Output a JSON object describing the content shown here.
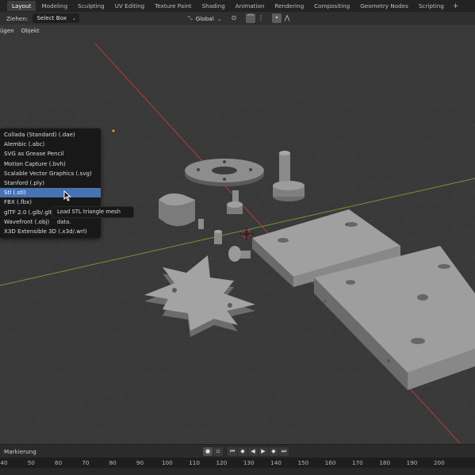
{
  "workspace_tabs": [
    "Layout",
    "Modeling",
    "Sculpting",
    "UV Editing",
    "Texture Paint",
    "Shading",
    "Animation",
    "Rendering",
    "Compositing",
    "Geometry Nodes",
    "Scripting"
  ],
  "add_tab_label": "+",
  "toolbar": {
    "drag_label": "Ziehen:",
    "select_mode": "Select Box",
    "orientation": "Global"
  },
  "viewport_menu": [
    "ügen",
    "Objekt"
  ],
  "export_menu": [
    {
      "label": "Collada (Standard) (.dae)",
      "mnemonic": "C"
    },
    {
      "label": "Alembic (.abc)",
      "mnemonic": "A"
    },
    {
      "label": "SVG as Grease Pencil",
      "mnemonic": "S"
    },
    {
      "label": "Motion Capture (.bvh)",
      "mnemonic": "M"
    },
    {
      "label": "Scalable Vector Graphics (.svg)",
      "mnemonic": ""
    },
    {
      "label": "Stanford (.ply)",
      "mnemonic": ""
    },
    {
      "label": "Stl (.stl)",
      "mnemonic": "St",
      "highlighted": true
    },
    {
      "label": "FBX (.fbx)",
      "mnemonic": "F"
    },
    {
      "label": "glTF 2.0 (.glb/.gltf)",
      "mnemonic": ""
    },
    {
      "label": "Wavefront (.obj)",
      "mnemonic": "W"
    },
    {
      "label": "X3D Extensible 3D (.x3d/.wrl)",
      "mnemonic": "X"
    }
  ],
  "tooltip": "Load STL triangle mesh data.",
  "timeline": {
    "marker_label": "Markierung",
    "ruler_ticks": [
      "40",
      "50",
      "60",
      "70",
      "80",
      "90",
      "100",
      "110",
      "120",
      "130",
      "140",
      "150",
      "160",
      "170",
      "180",
      "190",
      "200"
    ]
  },
  "colors": {
    "selection_highlight": "#4772b3",
    "x_axis": "#b83a3a",
    "y_axis": "#6f9a2d",
    "viewport_bg": "#393939"
  }
}
